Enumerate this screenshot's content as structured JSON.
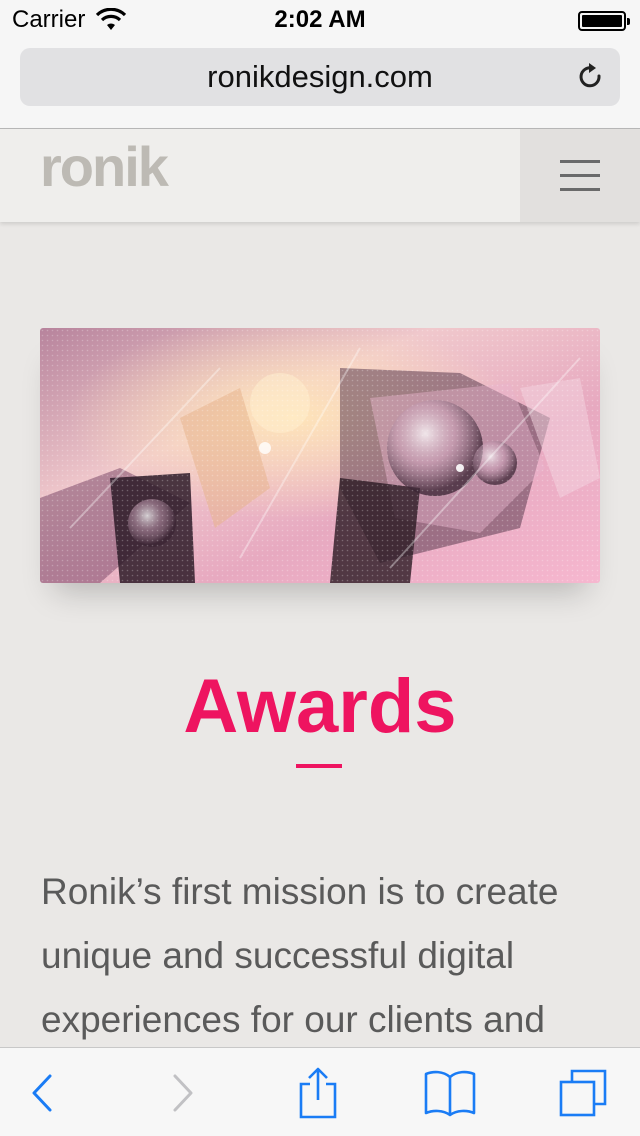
{
  "status_bar": {
    "carrier": "Carrier",
    "time": "2:02 AM",
    "wifi_icon": "wifi-icon",
    "battery_icon": "battery-icon"
  },
  "browser": {
    "url": "ronikdesign.com",
    "reload_icon": "reload-icon"
  },
  "site": {
    "logo": "ronik",
    "menu_icon": "hamburger-menu-icon",
    "heading": "Awards",
    "paragraph_lines": [
      "Ronik’s first mission is to create",
      "unique and successful digital",
      "experiences for our clients and"
    ]
  },
  "toolbar": {
    "items": [
      "back-icon",
      "forward-icon",
      "share-icon",
      "bookmarks-icon",
      "tabs-icon"
    ]
  },
  "colors": {
    "accent": "#ee1460",
    "ios_blue": "#1a7cf5",
    "logo": "#bdbab4",
    "background": "#eae8e6"
  }
}
